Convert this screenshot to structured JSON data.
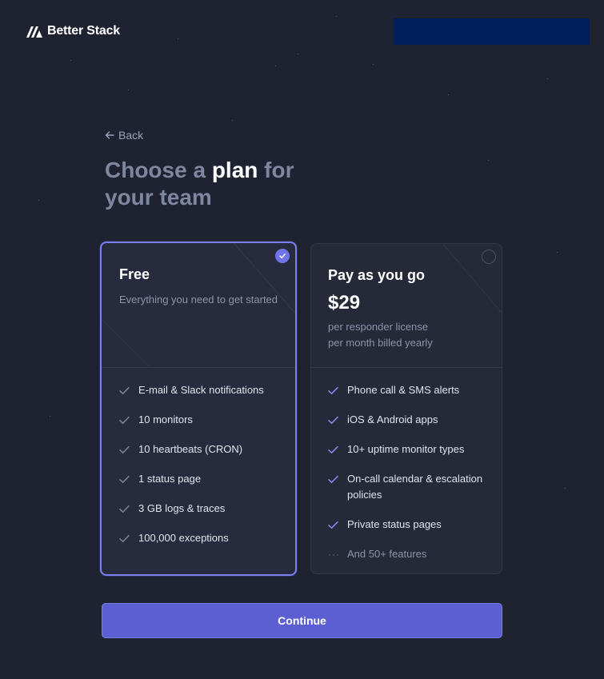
{
  "brand": {
    "name": "Better Stack",
    "banner_color": "#00205b"
  },
  "nav": {
    "back_label": "Back",
    "back_icon": "arrow-left-icon"
  },
  "heading": {
    "part1": "Choose a ",
    "emphasis": "plan",
    "part2": " for your team"
  },
  "plans": [
    {
      "name": "Free",
      "description": "Everything you need to get started",
      "selected": true,
      "features": [
        "E-mail & Slack notifications",
        "10 monitors",
        "10 heartbeats (CRON)",
        "1 status page",
        "3 GB logs & traces",
        "100,000 exceptions"
      ]
    },
    {
      "name": "Pay as you go",
      "price": "$29",
      "price_note_1": "per responder license",
      "price_note_2": "per month billed yearly",
      "selected": false,
      "features": [
        "Phone call & SMS alerts",
        "iOS & Android apps",
        "10+ uptime monitor types",
        "On-call calendar & escalation policies",
        "Private status pages"
      ],
      "more_label": "And 50+ features"
    }
  ],
  "actions": {
    "continue_label": "Continue"
  },
  "colors": {
    "background": "#1f2231",
    "accent": "#5b5fd1",
    "check_active": "#8a8ef5",
    "check_muted": "#7d8399"
  }
}
